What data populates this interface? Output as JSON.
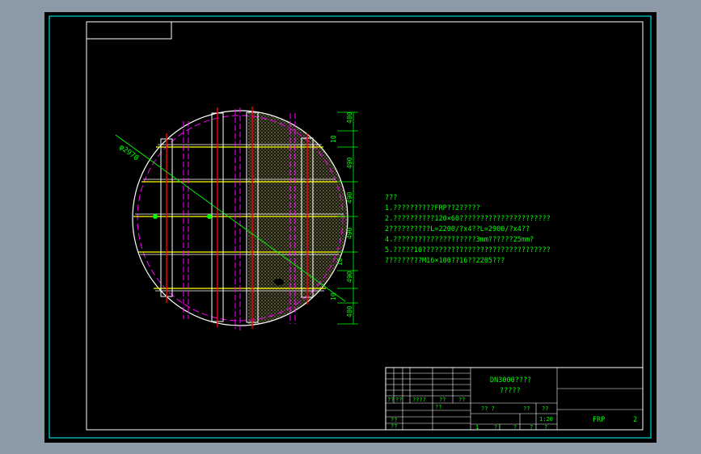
{
  "drawing": {
    "diameter_label": "φ2970",
    "dimensions_right": [
      "480",
      "10",
      "490",
      "490",
      "490",
      "10",
      "490",
      "10",
      "480"
    ],
    "notes": [
      "???",
      "1.??????????FRP??2?????",
      "2.??????????120×60??????????????????????",
      "2??????????L=2200/?x4??L=2900/?x4??",
      "4.????????????????????3mm??????25mm?",
      "5.?????10???????????????????????????????",
      "?????????M16×100??16??2205???"
    ]
  },
  "title_block": {
    "drawing_title": "DN3000????",
    "drawing_subtitle": "?????",
    "left_labels_row1": [
      "??",
      "??",
      "????",
      "??",
      "??"
    ],
    "left_labels_row2": [
      "??"
    ],
    "left_labels_row3": [
      "??",
      "??"
    ],
    "scale_header": "?? ?",
    "scale_cols": [
      "??",
      "??"
    ],
    "scale_value": "1:20",
    "sheet_labels": [
      "1",
      "?",
      "?",
      "?",
      "?"
    ],
    "material": "FRP",
    "sheet_number": "2"
  },
  "colors": {
    "background": "#000000",
    "frame": "#ffffff",
    "outer_border": "#00d8d8",
    "dimension": "#00ff00",
    "centerline": "#ff00ff",
    "beam": "#ffff00",
    "support": "#ff0000",
    "text": "#00ff00"
  }
}
